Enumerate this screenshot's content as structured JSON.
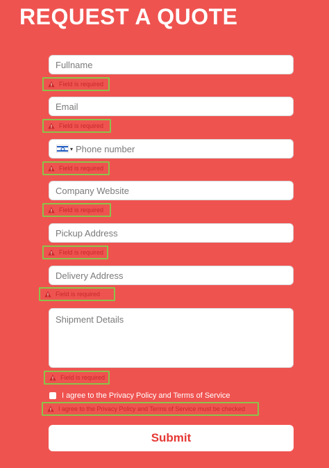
{
  "title": "REQUEST A QUOTE",
  "fields": {
    "fullname": "Fullname",
    "email": "Email",
    "phone": "Phone number",
    "website": "Company Website",
    "pickup": "Pickup Address",
    "delivery": "Delivery Address",
    "details": "Shipment Details"
  },
  "errors": {
    "required": "Field is required",
    "privacy": "I agree to the Privacy Policy and Terms of Service must be checked"
  },
  "privacy_label": "I agree to the Privacy Policy and Terms of Service",
  "submit_label": "Submit",
  "colors": {
    "background": "#ef5350",
    "error_outline": "#8bc34a",
    "error_text": "#c62828",
    "submit_text": "#e53935"
  },
  "icons": [
    "warning-icon",
    "israel-flag-icon",
    "caret-down-icon"
  ]
}
